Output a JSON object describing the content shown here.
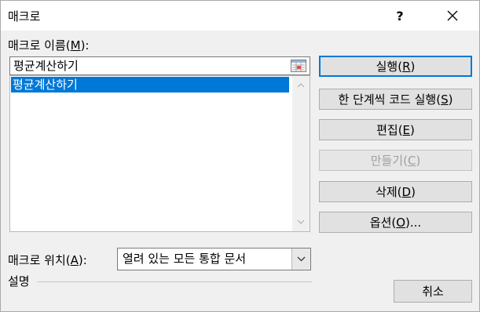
{
  "window": {
    "title": "매크로",
    "help_label": "?",
    "close_icon": "close-icon"
  },
  "macro_name": {
    "label_prefix": "매크로 이름(",
    "label_key": "M",
    "label_suffix": "):",
    "value": "평균계산하기",
    "ref_icon": "range-reference-icon"
  },
  "macro_list": {
    "items": [
      "평균계산하기"
    ],
    "selected_index": 0
  },
  "buttons": {
    "run": {
      "prefix": "실행(",
      "key": "R",
      "suffix": ")"
    },
    "step": {
      "prefix": "한 단계씩 코드 실행(",
      "key": "S",
      "suffix": ")"
    },
    "edit": {
      "prefix": "편집(",
      "key": "E",
      "suffix": ")"
    },
    "create": {
      "prefix": "만들기(",
      "key": "C",
      "suffix": ")"
    },
    "delete": {
      "prefix": "삭제(",
      "key": "D",
      "suffix": ")"
    },
    "options": {
      "prefix": "옵션(",
      "key": "O",
      "suffix": ")..."
    },
    "cancel": "취소"
  },
  "location": {
    "label_prefix": "매크로 위치(",
    "label_key": "A",
    "label_suffix": "):",
    "selected": "열려 있는 모든 통합 문서"
  },
  "description": {
    "label": "설명"
  },
  "colors": {
    "selection": "#0078d7",
    "dialog_bg": "#f0f0f0",
    "disabled_text": "#a0a0a0"
  }
}
